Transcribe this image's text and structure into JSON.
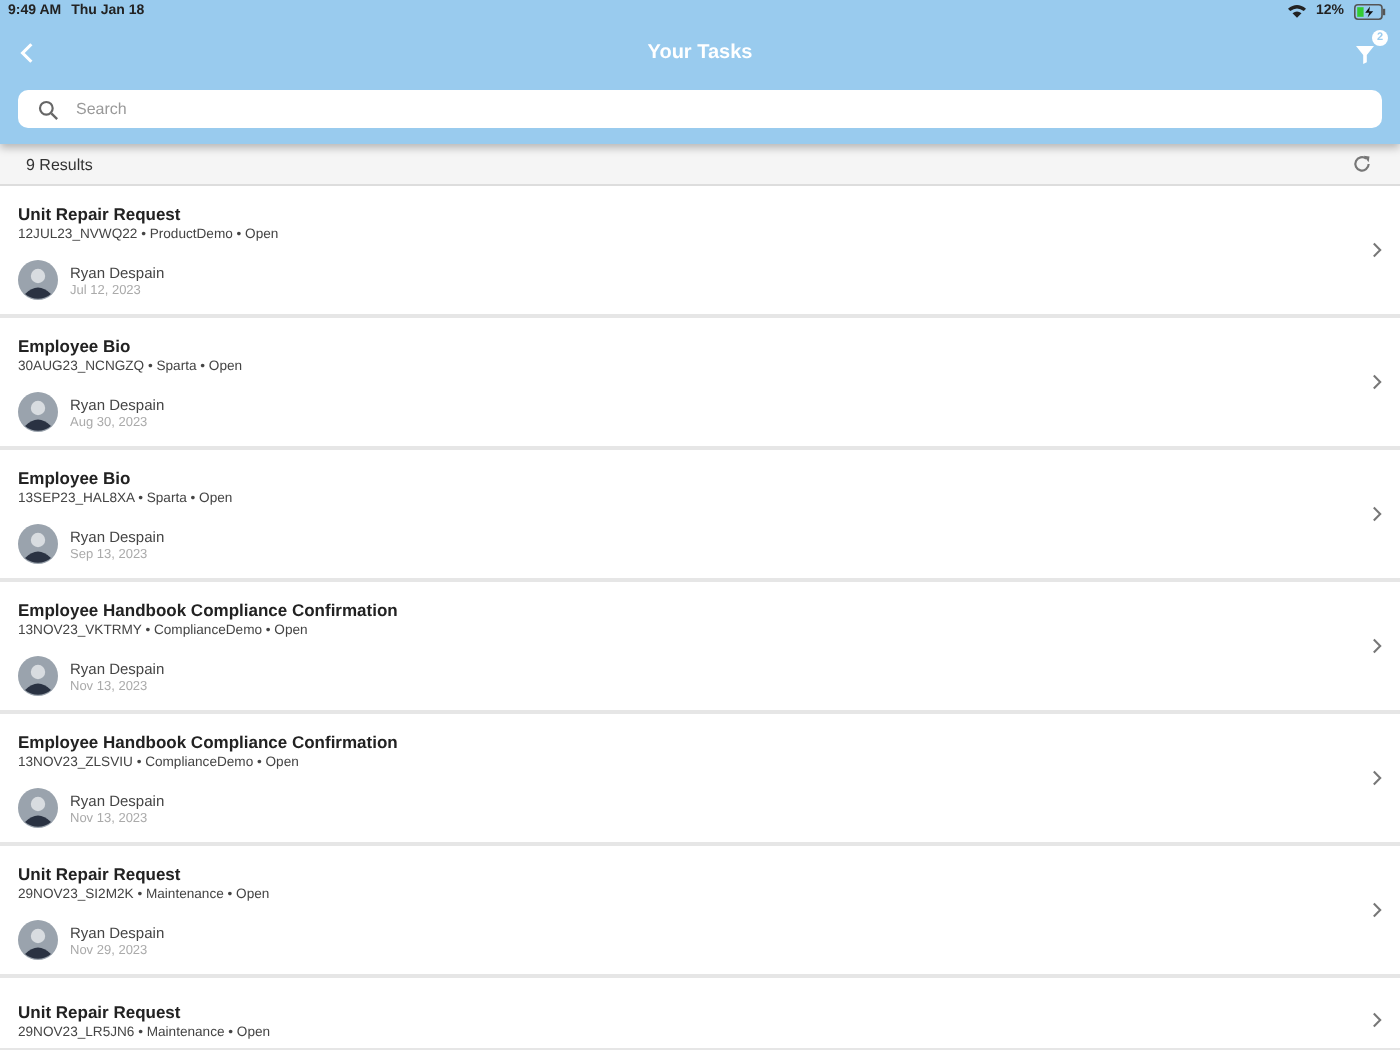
{
  "status_bar": {
    "time": "9:49 AM",
    "date": "Thu Jan 18",
    "battery": "12%"
  },
  "nav": {
    "title": "Your Tasks",
    "filter_badge": "2"
  },
  "search": {
    "placeholder": "Search"
  },
  "results": {
    "count": "9 Results"
  },
  "tasks": [
    {
      "title": "Unit Repair Request",
      "subtitle": "12JUL23_NVWQ22 • ProductDemo • Open",
      "person": "Ryan Despain",
      "date": "Jul 12, 2023"
    },
    {
      "title": "Employee Bio",
      "subtitle": "30AUG23_NCNGZQ • Sparta • Open",
      "person": "Ryan Despain",
      "date": "Aug 30, 2023"
    },
    {
      "title": "Employee Bio",
      "subtitle": "13SEP23_HAL8XA • Sparta • Open",
      "person": "Ryan Despain",
      "date": "Sep 13, 2023"
    },
    {
      "title": "Employee Handbook Compliance Confirmation",
      "subtitle": "13NOV23_VKTRMY • ComplianceDemo • Open",
      "person": "Ryan Despain",
      "date": "Nov 13, 2023"
    },
    {
      "title": "Employee Handbook Compliance Confirmation",
      "subtitle": "13NOV23_ZLSVIU • ComplianceDemo • Open",
      "person": "Ryan Despain",
      "date": "Nov 13, 2023"
    },
    {
      "title": "Unit Repair Request",
      "subtitle": "29NOV23_SI2M2K • Maintenance • Open",
      "person": "Ryan Despain",
      "date": "Nov 29, 2023"
    },
    {
      "title": "Unit Repair Request",
      "subtitle": "29NOV23_LR5JN6 • Maintenance • Open"
    }
  ]
}
